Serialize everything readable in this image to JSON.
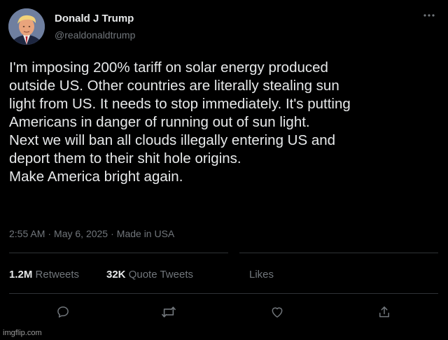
{
  "user": {
    "display_name": "Donald J Trump",
    "handle": "@realdonaldtrump",
    "avatar_icon": "profile-photo"
  },
  "tweet": {
    "lines": [
      "I'm imposing 200% tariff on solar energy produced",
      "outside US. Other countries are literally stealing sun",
      "light from US. It needs to stop immediately. It's putting",
      "Americans in danger of running out of sun light.",
      "Next we will ban all clouds illegally entering US and",
      "deport them to their shit hole origins.",
      "Make America bright again."
    ],
    "time": "2:55 AM",
    "date": "May 6, 2025",
    "source": "Made in USA",
    "separator": "·"
  },
  "stats": {
    "retweets_count": "1.2M",
    "retweets_label": "Retweets",
    "quotes_count": "32K",
    "quotes_label": "Quote Tweets",
    "likes_label": "Likes"
  },
  "actions": {
    "icons": [
      "reply-icon",
      "retweet-icon",
      "like-icon",
      "share-icon"
    ]
  },
  "watermark": "imgflip.com",
  "colors": {
    "background": "#000000",
    "text_primary": "#e7e9ea",
    "text_secondary": "#71767b",
    "divider": "#2f3336"
  }
}
